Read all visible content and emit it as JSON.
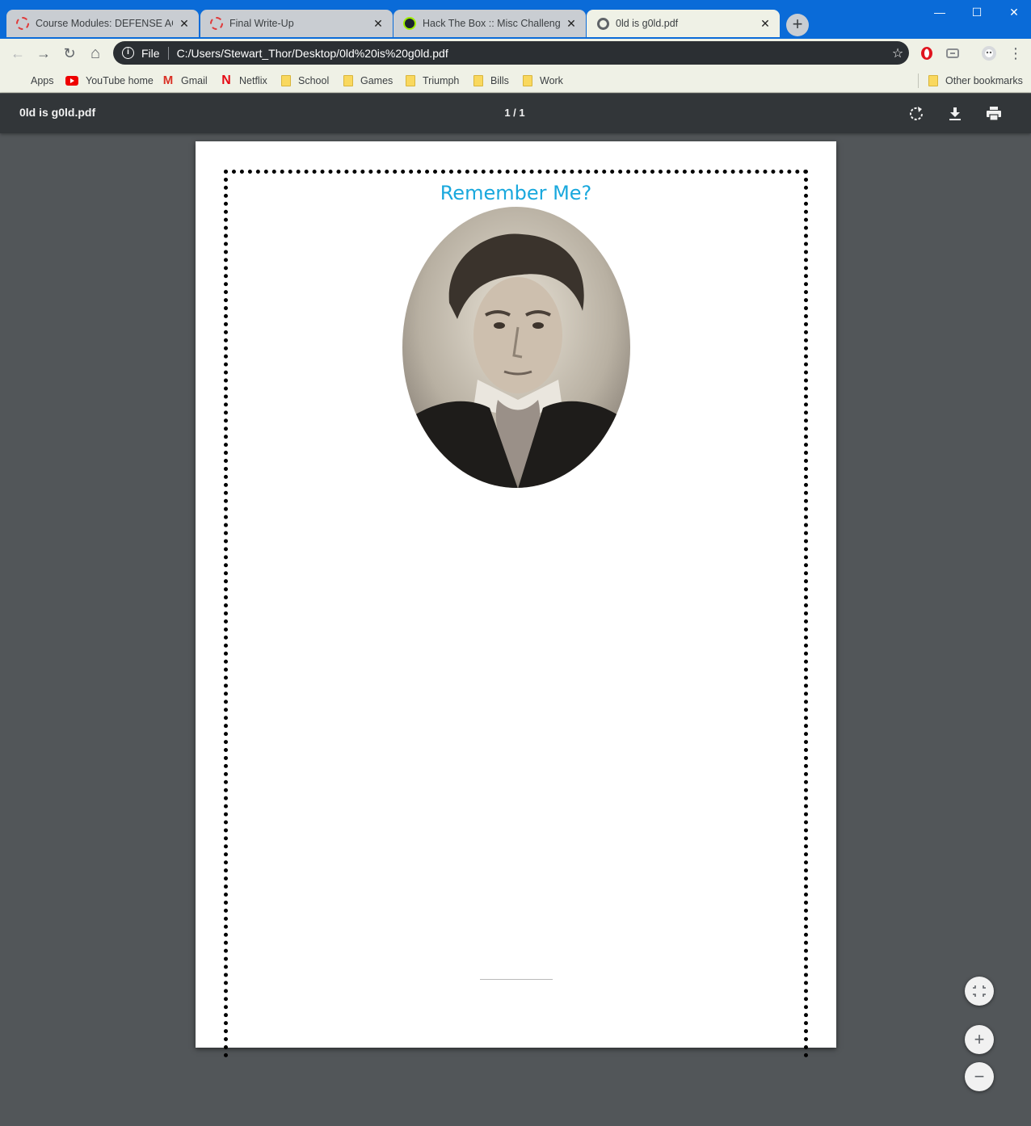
{
  "tabs": [
    {
      "title": "Course Modules: DEFENSE AGAIN",
      "favicon": "dotted-ring-icon"
    },
    {
      "title": "Final Write-Up",
      "favicon": "dotted-ring-icon"
    },
    {
      "title": "Hack The Box :: Misc Challenges",
      "favicon": "htb-cube-icon"
    },
    {
      "title": "0ld is g0ld.pdf",
      "favicon": "globe-icon",
      "active": true
    }
  ],
  "tab_close_glyph": "✕",
  "new_tab_glyph": "+",
  "window_controls": {
    "minimize": "—",
    "maximize": "☐",
    "close": "✕"
  },
  "toolbar": {
    "back": "←",
    "forward": "→",
    "reload": "↻",
    "home": "⌂",
    "info_glyph": "i",
    "scheme": "File",
    "url": "C:/Users/Stewart_Thor/Desktop/0ld%20is%20g0ld.pdf",
    "star": "☆",
    "menu": "⋮"
  },
  "bookmarks": {
    "items": [
      {
        "label": "Apps",
        "icon": "apps-grid-icon"
      },
      {
        "label": "YouTube home",
        "icon": "youtube-icon"
      },
      {
        "label": "Gmail",
        "icon": "gmail-icon"
      },
      {
        "label": "Netflix",
        "icon": "netflix-icon"
      },
      {
        "label": "School",
        "icon": "folder-icon"
      },
      {
        "label": "Games",
        "icon": "folder-icon"
      },
      {
        "label": "Triumph",
        "icon": "folder-icon"
      },
      {
        "label": "Bills",
        "icon": "folder-icon"
      },
      {
        "label": "Work",
        "icon": "folder-icon"
      }
    ],
    "other": "Other bookmarks",
    "gmail_glyph": "M",
    "netflix_glyph": "N"
  },
  "pdf_viewer": {
    "filename": "0ld is g0ld.pdf",
    "page_indicator": "1 / 1",
    "rotate": "rotate-icon",
    "download": "download-icon",
    "print": "print-icon"
  },
  "document": {
    "heading": "Remember Me?"
  },
  "zoom_controls": {
    "fit": "fit-to-page-icon",
    "zoom_in": "+",
    "zoom_out": "−"
  },
  "colors": {
    "titlebar": "#0a6bd8",
    "toolbar": "#eff1e6",
    "pdf_bar": "#323639",
    "viewer_bg": "#525659",
    "heading": "#19a8dd"
  }
}
